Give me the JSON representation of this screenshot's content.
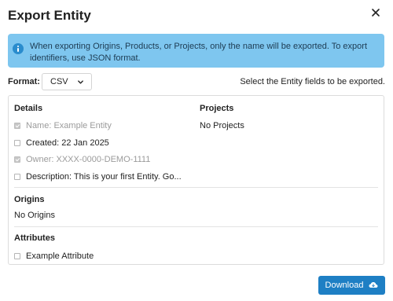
{
  "dialog": {
    "title": "Export Entity",
    "close_icon": "close-icon"
  },
  "info": {
    "icon": "info-icon",
    "color": "#7ec6ef",
    "text": "When exporting Origins, Products, or Projects, only the name will be exported. To export identifiers, use JSON format."
  },
  "format": {
    "label": "Format:",
    "selected": "CSV",
    "hint": "Select the Entity fields to be exported."
  },
  "details": {
    "heading": "Details",
    "items": [
      {
        "label": "Name: Example Entity",
        "checked": true,
        "disabled": true
      },
      {
        "label": "Created: 22 Jan 2025",
        "checked": false,
        "disabled": false
      },
      {
        "label": "Owner: XXXX-0000-DEMO-1111",
        "checked": true,
        "disabled": true
      },
      {
        "label": "Description: This is your first Entity. Go...",
        "checked": false,
        "disabled": false
      }
    ]
  },
  "projects": {
    "heading": "Projects",
    "empty": "No Projects"
  },
  "origins": {
    "heading": "Origins",
    "empty": "No Origins"
  },
  "attributes": {
    "heading": "Attributes",
    "items": [
      {
        "label": "Example Attribute",
        "checked": false,
        "disabled": false
      }
    ]
  },
  "footer": {
    "download_label": "Download",
    "download_icon": "cloud-download-icon",
    "accent": "#1e7fc4"
  }
}
